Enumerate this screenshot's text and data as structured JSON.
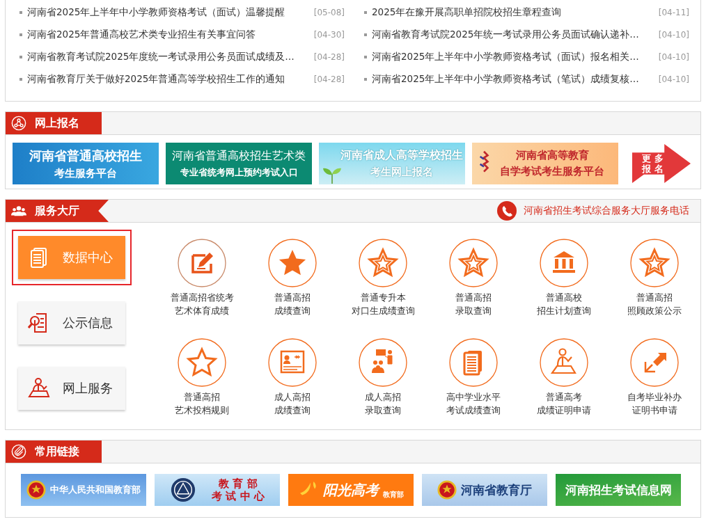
{
  "news": [
    {
      "title": "河南省2025年上半年中小学教师资格考试（面试）温馨提醒",
      "date": "[05-08]"
    },
    {
      "title": "2025年在豫开展高职单招院校招生章程查询",
      "date": "[04-11]"
    },
    {
      "title": "河南省2025年普通高校艺术类专业招生有关事宜问答",
      "date": "[04-30]"
    },
    {
      "title": "河南省教育考试院2025年统一考试录用公务员面试确认递补…",
      "date": "[04-10]"
    },
    {
      "title": "河南省教育考试院2025年度统一考试录用公务员面试成绩及…",
      "date": "[04-28]"
    },
    {
      "title": "河南省2025年上半年中小学教师资格考试（面试）报名相关…",
      "date": "[04-10]"
    },
    {
      "title": "河南省教育厅关于做好2025年普通高等学校招生工作的通知",
      "date": "[04-28]"
    },
    {
      "title": "河南省2025年上半年中小学教师资格考试（笔试）成绩复核…",
      "date": "[04-10]"
    }
  ],
  "registration": {
    "title": "网上报名",
    "banners": [
      {
        "lines": [
          "河南省普通高校招生",
          "考生服务平台"
        ]
      },
      {
        "lines": [
          "河南省普通高校招生艺术类",
          "专业省统考网上预约考试入口"
        ]
      },
      {
        "lines": [
          "河南省成人高等学校招生",
          "考生网上报名"
        ]
      },
      {
        "lines": [
          "河南省高等教育",
          "自学考试考生服务平台"
        ]
      }
    ],
    "more": [
      "更 多",
      "报 名"
    ]
  },
  "service": {
    "title": "服务大厅",
    "phone": "河南省招生考试综合服务大厅服务电话",
    "menu": [
      {
        "label": "数据中心",
        "selected": true
      },
      {
        "label": "公示信息",
        "selected": false
      },
      {
        "label": "网上服务",
        "selected": false
      }
    ],
    "items": [
      {
        "lines": [
          "普通高招省统考",
          "艺术体育成绩"
        ]
      },
      {
        "lines": [
          "普通高招",
          "成绩查询"
        ]
      },
      {
        "lines": [
          "普通专升本",
          "对口生成绩查询"
        ]
      },
      {
        "lines": [
          "普通高招",
          "录取查询"
        ]
      },
      {
        "lines": [
          "普通高校",
          "招生计划查询"
        ]
      },
      {
        "lines": [
          "普通高招",
          "照顾政策公示"
        ]
      },
      {
        "lines": [
          "普通高招",
          "艺术投档规则"
        ]
      },
      {
        "lines": [
          "成人高招",
          "成绩查询"
        ]
      },
      {
        "lines": [
          "成人高招",
          "录取查询"
        ]
      },
      {
        "lines": [
          "高中学业水平",
          "考试成绩查询"
        ]
      },
      {
        "lines": [
          "普通高考",
          "成绩证明申请"
        ]
      },
      {
        "lines": [
          "自考毕业补办",
          "证明书申请"
        ]
      }
    ]
  },
  "links": {
    "title": "常用链接",
    "logos": [
      {
        "lines": [
          "中华人民共和国教育部"
        ]
      },
      {
        "lines": [
          "教 育 部",
          "考 试 中 心"
        ]
      },
      {
        "lines": [
          "阳光高考",
          "教育部"
        ]
      },
      {
        "lines": [
          "河南省教育厅"
        ]
      },
      {
        "lines": [
          "河南招生考试信息网"
        ]
      }
    ]
  }
}
